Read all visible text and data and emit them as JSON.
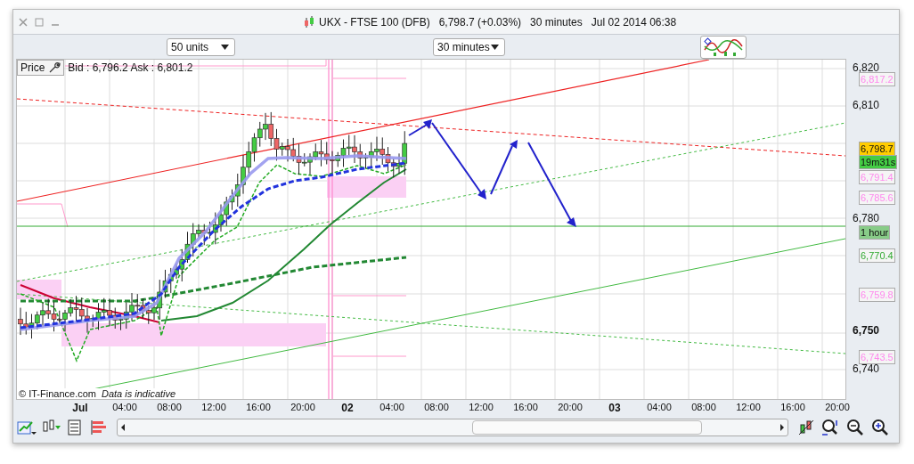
{
  "window": {
    "title": "UKX - FTSE 100 (DFB)",
    "quote": "6,798.7 (+0.03%)",
    "interval": "30 minutes",
    "timestamp": "Jul 02 2014 06:38"
  },
  "toolbar": {
    "units_dropdown": "50 units",
    "interval_dropdown": "30 minutes"
  },
  "legend": {
    "price_button": "Price",
    "bid_ask": "Bid : 6,796.2 Ask : 6,801.2"
  },
  "price_axis": {
    "ticks": [
      {
        "label": "6,820",
        "bold": false
      },
      {
        "label": "6,810",
        "bold": false
      },
      {
        "label": "6,780",
        "bold": false
      },
      {
        "label": "6,750",
        "bold": true
      },
      {
        "label": "6,740",
        "bold": false
      }
    ],
    "tags": [
      {
        "label": "6,817.2",
        "kind": "outline",
        "color": "#ff88ee"
      },
      {
        "label": "6,798.7",
        "kind": "filled",
        "color": "#ffcc00"
      },
      {
        "label": "19m31s",
        "kind": "filled",
        "color": "#44cc44"
      },
      {
        "label": "6,791.4",
        "kind": "outline",
        "color": "#ff88ee"
      },
      {
        "label": "6,785.6",
        "kind": "outline",
        "color": "#ff88ee"
      },
      {
        "label": "1 hour",
        "kind": "filled",
        "color": "#88cc88"
      },
      {
        "label": "6,770.4",
        "kind": "outline",
        "color": "#33aa33"
      },
      {
        "label": "6,759.8",
        "kind": "outline",
        "color": "#ff88ee"
      },
      {
        "label": "6,743.5",
        "kind": "outline",
        "color": "#ff88ee"
      }
    ]
  },
  "time_axis": [
    {
      "label": "Jul",
      "bold": true
    },
    {
      "label": "04:00",
      "bold": false
    },
    {
      "label": "08:00",
      "bold": false
    },
    {
      "label": "12:00",
      "bold": false
    },
    {
      "label": "16:00",
      "bold": false
    },
    {
      "label": "20:00",
      "bold": false
    },
    {
      "label": "02",
      "bold": true
    },
    {
      "label": "04:00",
      "bold": false
    },
    {
      "label": "08:00",
      "bold": false
    },
    {
      "label": "12:00",
      "bold": false
    },
    {
      "label": "16:00",
      "bold": false
    },
    {
      "label": "20:00",
      "bold": false
    },
    {
      "label": "03",
      "bold": true
    },
    {
      "label": "04:00",
      "bold": false
    },
    {
      "label": "08:00",
      "bold": false
    },
    {
      "label": "12:00",
      "bold": false
    },
    {
      "label": "16:00",
      "bold": false
    },
    {
      "label": "20:00",
      "bold": false
    }
  ],
  "footer": {
    "copyright": "© IT-Finance.com",
    "note": "Data is indicative"
  }
}
